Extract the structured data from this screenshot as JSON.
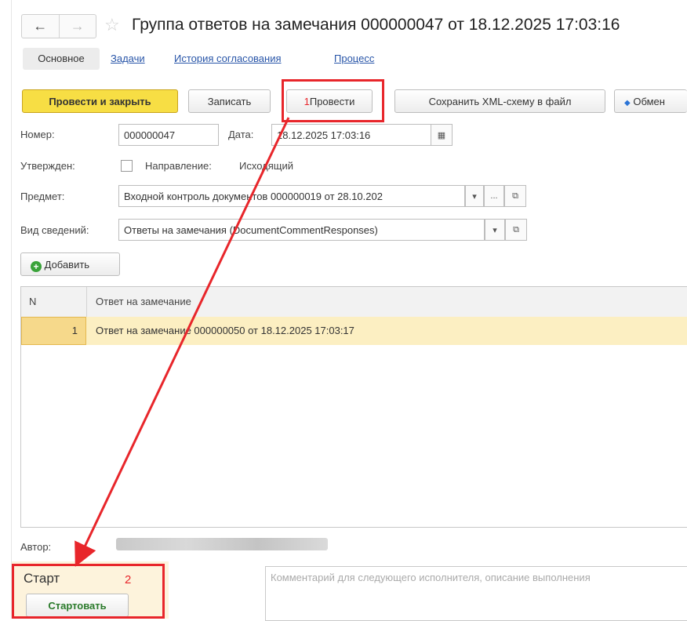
{
  "nav": {
    "back_icon": "←",
    "forward_icon": "→",
    "star_icon": "☆"
  },
  "title": "Группа ответов на замечания 000000047 от 18.12.2025 17:03:16",
  "tabs": {
    "main": "Основное",
    "tasks": "Задачи",
    "history": "История согласования",
    "process": "Процесс"
  },
  "toolbar": {
    "post_close": "Провести и закрыть",
    "save": "Записать",
    "post_num": "1",
    "post": "Провести",
    "save_xml": "Сохранить XML-схему в файл",
    "exchange": "Обмен"
  },
  "form": {
    "number_label": "Номер:",
    "number_value": "000000047",
    "date_label": "Дата:",
    "date_value": "18.12.2025 17:03:16",
    "approved_label": "Утвержден:",
    "direction_label": "Направление:",
    "direction_value": "Исходящий",
    "subject_label": "Предмет:",
    "subject_value": "Входной контроль документов 000000019 от 28.10.202",
    "info_label": "Вид сведений:",
    "info_value": "Ответы на замечания (DocumentCommentResponses)",
    "dots": "...",
    "dropdown_icon": "▾",
    "open_icon": "⧉",
    "calendar_icon": "▦"
  },
  "add_button": {
    "icon": "+",
    "label": "Добавить"
  },
  "table": {
    "col_n": "N",
    "col_answer": "Ответ на замечание",
    "rows": [
      {
        "n": "1",
        "answer": "Ответ на замечание 000000050 от 18.12.2025 17:03:17"
      }
    ]
  },
  "author_label": "Автор:",
  "start": {
    "title": "Старт",
    "num": "2",
    "button": "Стартовать",
    "comment_placeholder": "Комментарий для следующего исполнителя, описание выполнения"
  },
  "colors": {
    "primary_button": "#f7de44",
    "annotation_red": "#e8262b",
    "link_blue": "#2855a8",
    "selected_row": "#fcefc2",
    "start_panel": "#fdf3dc"
  }
}
